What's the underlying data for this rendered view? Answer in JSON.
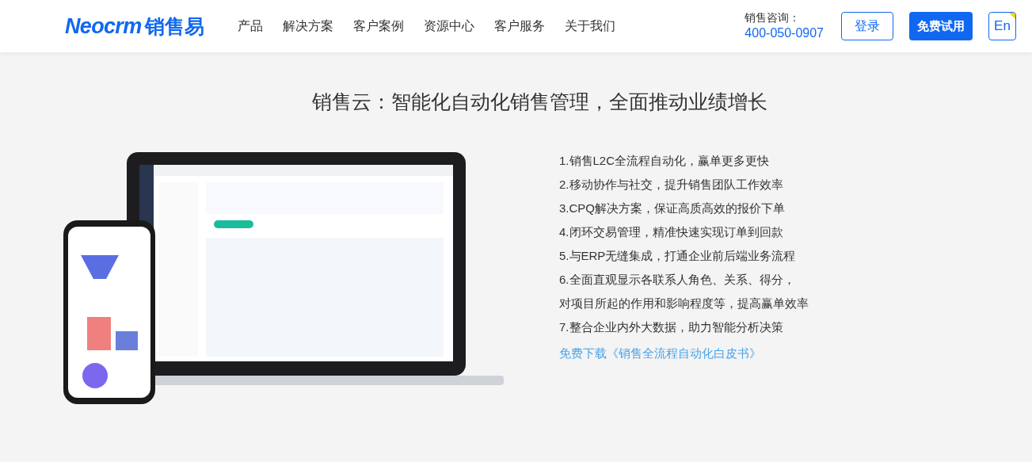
{
  "header": {
    "logo": {
      "latin": "Neocrm",
      "cjk": "销售易"
    },
    "nav": [
      "产品",
      "解决方案",
      "客户案例",
      "资源中心",
      "客户服务",
      "关于我们"
    ],
    "contact": {
      "label": "销售咨询：",
      "phone": "400-050-0907"
    },
    "login": "登录",
    "trial": "免费试用",
    "language": "En"
  },
  "hero": {
    "title": "销售云：智能化自动化销售管理，全面推动业绩增长",
    "features": [
      "1.销售L2C全流程自动化，赢单更多更快",
      "2.移动协作与社交，提升销售团队工作效率",
      "3.CPQ解决方案，保证高质高效的报价下单",
      "4.闭环交易管理，精准快速实现订单到回款",
      "5.与ERP无缝集成，打通企业前后端业务流程",
      "6.全面直观显示各联系人角色、关系、得分，",
      "对项目所起的作用和影响程度等，提高赢单效率",
      "7.整合企业内外大数据，助力智能分析决策"
    ],
    "download_link": "免费下载《销售全流程自动化白皮书》"
  }
}
